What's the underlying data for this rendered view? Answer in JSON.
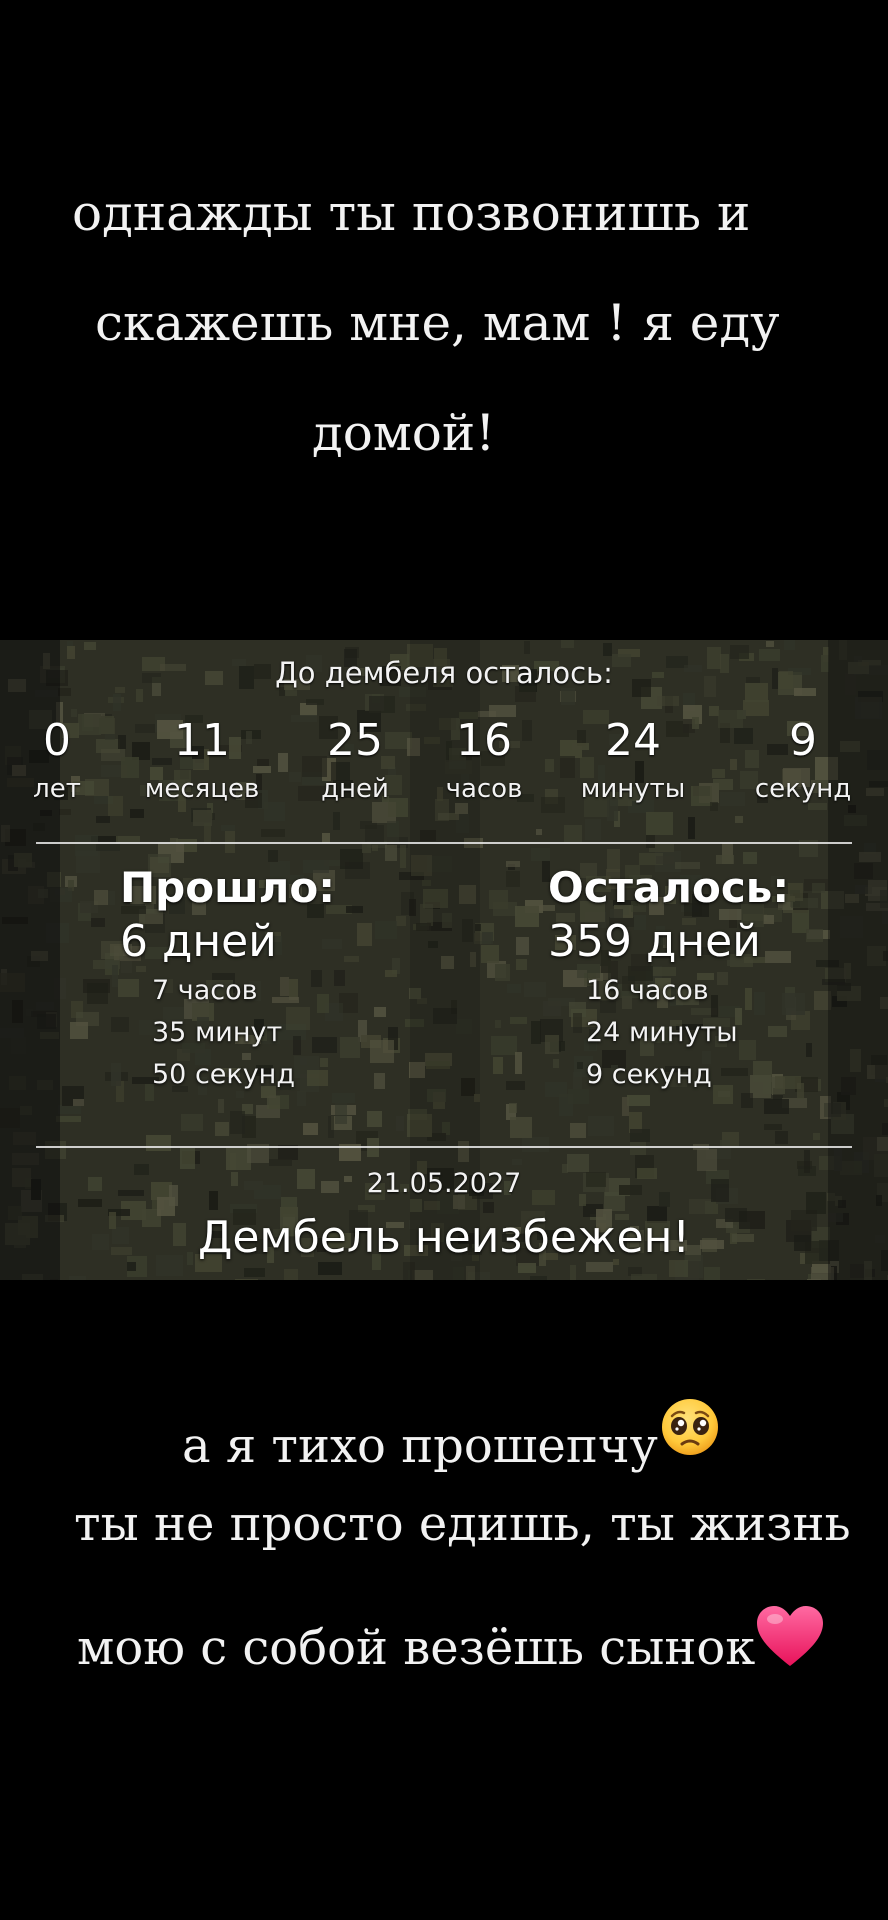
{
  "caption_top": {
    "line1": "однажды  ты позвонишь и",
    "line2": "скажешь мне, мам ! я еду",
    "line3": "домой!"
  },
  "counter": {
    "title": "До дембеля осталось:",
    "units": [
      {
        "value": "0",
        "label": "лет"
      },
      {
        "value": "11",
        "label": "месяцев"
      },
      {
        "value": "25",
        "label": "дней"
      },
      {
        "value": "16",
        "label": "часов"
      },
      {
        "value": "24",
        "label": "минуты"
      },
      {
        "value": "9",
        "label": "секунд"
      }
    ],
    "passed": {
      "heading": "Прошло:",
      "days": "6 дней",
      "hours": "7 часов",
      "minutes": "35 минут",
      "seconds": "50 секунд"
    },
    "remaining": {
      "heading": "Осталось:",
      "days": "359 дней",
      "hours": "16 часов",
      "minutes": "24 минуты",
      "seconds": "9 секунд"
    },
    "date": "21.05.2027",
    "motto": "Дембель неизбежен!"
  },
  "caption_bottom": {
    "line1": "а я тихо прошепчу",
    "line2": "ты не просто едишь, ты жизнь",
    "line3": "мою с собой  везёшь сынок"
  },
  "icons": {
    "line1_end": "pleading-face-icon",
    "line3_end": "heart-icon"
  },
  "colors": {
    "background": "#000000",
    "text": "#f2f2f2",
    "heart": "#ff2f7a",
    "emoji_face": "#ffcc33"
  }
}
